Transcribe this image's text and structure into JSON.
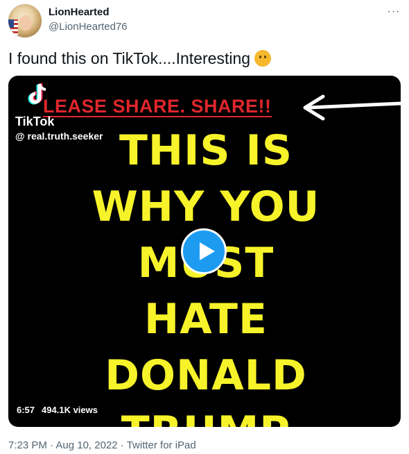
{
  "author": {
    "display_name": "LionHearted",
    "handle": "@LionHearted76"
  },
  "more_label": "···",
  "tweet": {
    "text": "I found this on TikTok....Interesting",
    "emoji": "thinking-face-icon"
  },
  "video": {
    "banner": "LEASE SHARE.   SHARE!!",
    "platform": "TikTok",
    "uploader": "@ real.truth.seeker",
    "headline_lines": [
      "THIS IS",
      "WHY YOU",
      "MUST",
      "HATE",
      "DONALD",
      "TRUMP"
    ],
    "duration": "6:57",
    "views": "494.1K views",
    "play_icon": "play-icon"
  },
  "meta": {
    "time": "7:23 PM",
    "date": "Aug 10, 2022",
    "source": "Twitter for iPad",
    "separator": " · "
  },
  "colors": {
    "accent": "#1d9bf0",
    "headline": "#f7f32a",
    "banner": "#e0262c",
    "secondary_text": "#536471"
  }
}
